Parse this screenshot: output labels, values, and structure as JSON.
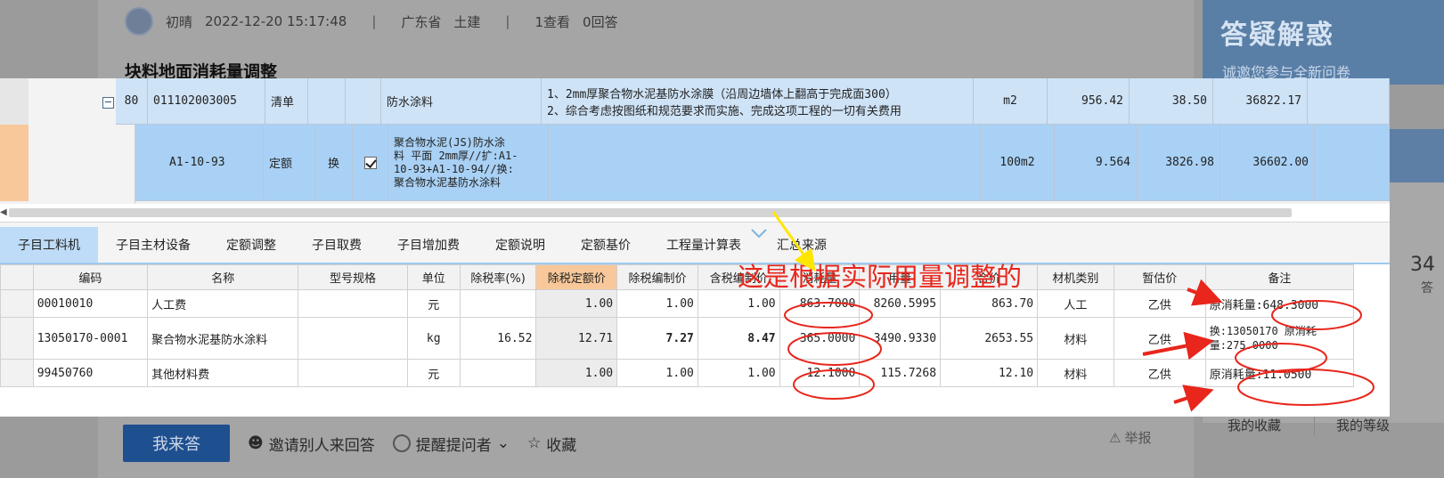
{
  "background": {
    "author": "初晴",
    "datetime": "2022-12-20 15:17:48",
    "region": "广东省",
    "category": "土建",
    "views": "1查看",
    "answers": "0回答",
    "question_title": "块料地面消耗量调整",
    "banner_title": "答疑解惑",
    "banner_sub": "诚邀您参与全新问卷",
    "side_number": "34",
    "side_answer": "答",
    "my_collect": "我的收藏",
    "my_level": "我的等级",
    "actions": {
      "answer": "我来答",
      "invite": "邀请别人来回答",
      "remind": "提醒提问者",
      "favorite": "收藏",
      "report": "举报"
    }
  },
  "top_grid": {
    "row1": {
      "seq": "80",
      "code": "011102003005",
      "type": "清单",
      "name": "防水涂料",
      "desc_line1": "1、2mm厚聚合物水泥基防水涂膜（沿周边墙体上翻高于完成面300）",
      "desc_line2": "2、综合考虑按图纸和规范要求而实施、完成这项工程的一切有关费用",
      "unit": "m2",
      "qty": "956.42",
      "price": "38.50",
      "total": "36822.17"
    },
    "row2": {
      "code": "A1-10-93",
      "type": "定额",
      "swap": "换",
      "name_lines": [
        "聚合物水泥(JS)防水涂",
        "料 平面 2mm厚//扩:A1-",
        "10-93+A1-10-94//换:",
        "聚合物水泥基防水涂料"
      ],
      "unit": "100m2",
      "qty": "9.564",
      "price": "3826.98",
      "total": "36602.00"
    }
  },
  "tabs": [
    "子目工料机",
    "子目主材设备",
    "定额调整",
    "子目取费",
    "子目增加费",
    "定额说明",
    "定额基价",
    "工程量计算表",
    "汇总来源"
  ],
  "table": {
    "headers": [
      "编码",
      "名称",
      "型号规格",
      "单位",
      "除税率(%)",
      "除税定额价",
      "除税编制价",
      "含税编制价",
      "消耗量",
      "用量",
      "合价",
      "材机类别",
      "暂估价",
      "备注"
    ],
    "rows": [
      {
        "code": "00010010",
        "name": "人工费",
        "spec": "",
        "unit": "元",
        "rate": "",
        "quota": "1.00",
        "ex_price": "1.00",
        "in_price": "1.00",
        "consume": "863.7000",
        "usage": "8260.5995",
        "total": "863.70",
        "kind": "人工",
        "est": "乙供",
        "note": "原消耗量:648.3000"
      },
      {
        "code": "13050170-0001",
        "name": "聚合物水泥基防水涂料",
        "spec": "",
        "unit": "kg",
        "rate": "16.52",
        "quota": "12.71",
        "ex_price": "7.27",
        "in_price": "8.47",
        "consume": "365.0000",
        "usage": "3490.9330",
        "total": "2653.55",
        "kind": "材料",
        "est": "乙供",
        "note": "换:13050170 原消耗量:275.0000"
      },
      {
        "code": "99450760",
        "name": "其他材料费",
        "spec": "",
        "unit": "元",
        "rate": "",
        "quota": "1.00",
        "ex_price": "1.00",
        "in_price": "1.00",
        "consume": "12.1000",
        "usage": "115.7268",
        "total": "12.10",
        "kind": "材料",
        "est": "乙供",
        "note": "原消耗量:11.0500"
      }
    ]
  },
  "annotation_text": "这是根据实际用量调整的",
  "colors": {
    "highlight_row": "#a9d1f5",
    "list_row": "#cfe3f7",
    "orange_header": "#f8c89a",
    "annot_red": "#e8261c",
    "arrow_yellow": "#ffe600"
  }
}
